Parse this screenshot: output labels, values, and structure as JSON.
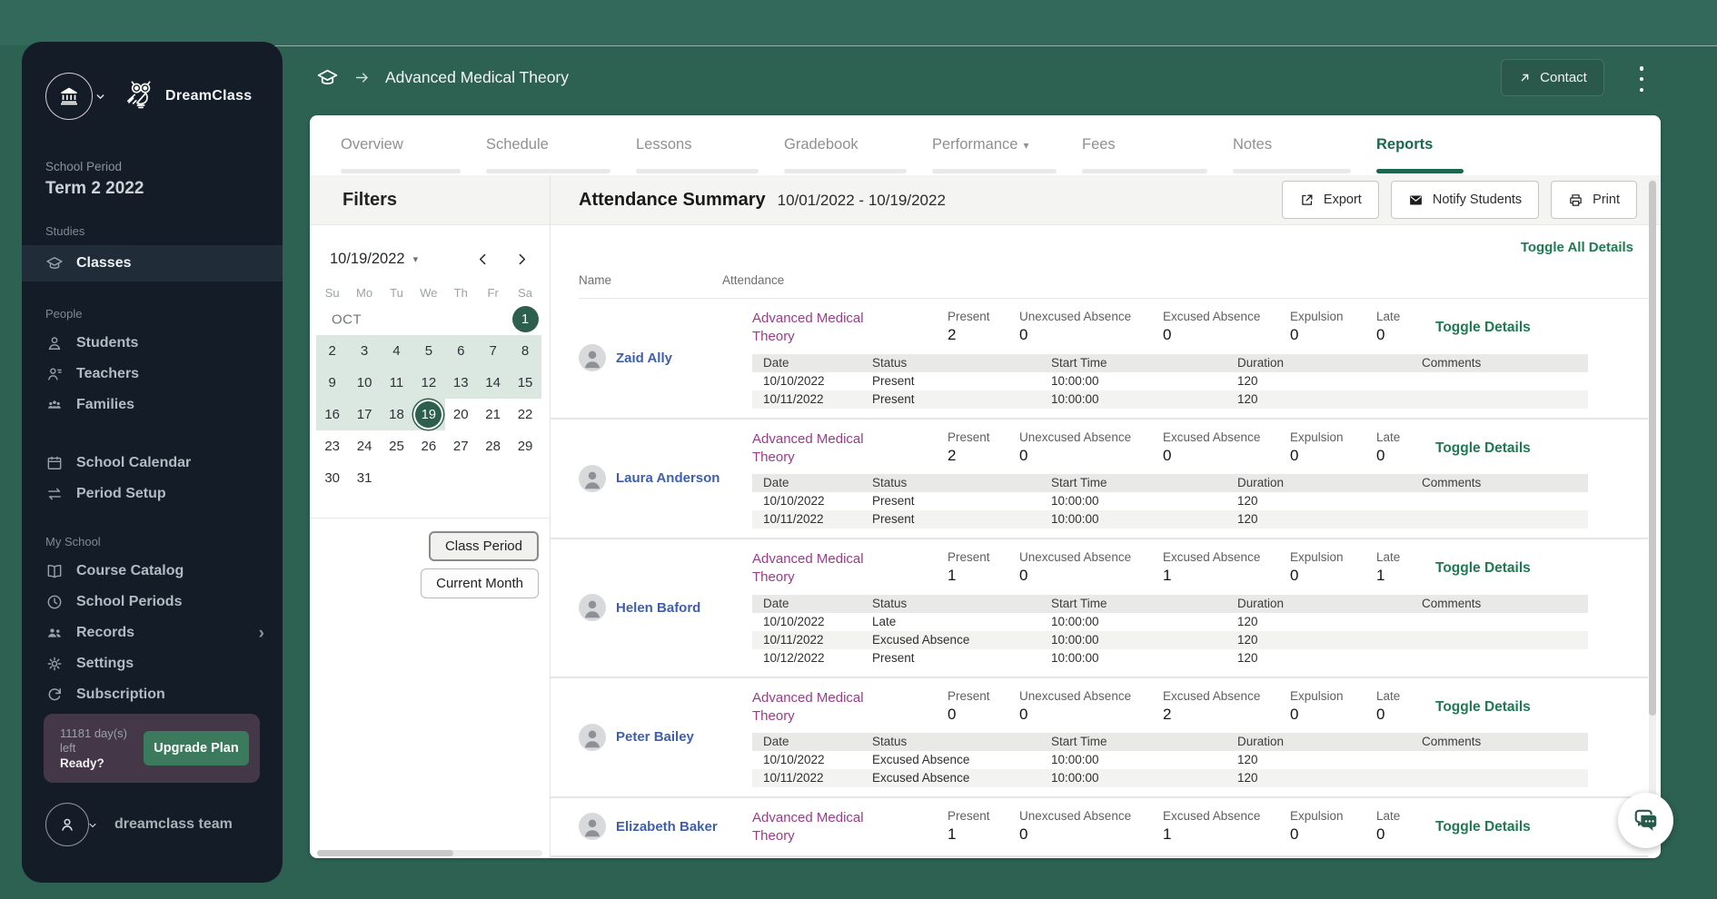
{
  "app": {
    "breadcrumb_title": "Advanced Medical Theory",
    "contact_label": "Contact"
  },
  "colors": {
    "background_green": "#2d6152",
    "sidebar_bg": "#141d27",
    "accent_green": "#1d6650",
    "calendar_highlight": "#dbe7e1",
    "selected_day": "#2d5f4e",
    "link_blue": "#3e5fae",
    "class_purple": "#9c3a8c",
    "upgrade_panel": "#443747"
  },
  "sidebar": {
    "brand": "DreamClass",
    "school_period_label": "School Period",
    "school_period_value": "Term 2 2022",
    "sections": [
      {
        "label": "Studies",
        "items": [
          {
            "label": "Classes",
            "icon": "grad-cap",
            "active": true
          }
        ]
      },
      {
        "label": "People",
        "items": [
          {
            "label": "Students",
            "icon": "student"
          },
          {
            "label": "Teachers",
            "icon": "teacher"
          },
          {
            "label": "Families",
            "icon": "families"
          }
        ]
      },
      {
        "label": "",
        "items": [
          {
            "label": "School Calendar",
            "icon": "calendar"
          },
          {
            "label": "Period Setup",
            "icon": "swap"
          }
        ]
      },
      {
        "label": "My School",
        "items": [
          {
            "label": "Course Catalog",
            "icon": "book"
          },
          {
            "label": "School Periods",
            "icon": "clock"
          },
          {
            "label": "Records",
            "icon": "people",
            "chevron": true
          },
          {
            "label": "Settings",
            "icon": "gear"
          },
          {
            "label": "Subscription",
            "icon": "refresh"
          }
        ]
      }
    ],
    "upgrade": {
      "days_line1": "11181 day(s)",
      "days_line2": "left",
      "ready": "Ready?",
      "button": "Upgrade Plan"
    },
    "account": "dreamclass team"
  },
  "tabs": [
    {
      "label": "Overview"
    },
    {
      "label": "Schedule"
    },
    {
      "label": "Lessons"
    },
    {
      "label": "Gradebook"
    },
    {
      "label": "Performance",
      "caret": true
    },
    {
      "label": "Fees"
    },
    {
      "label": "Notes"
    },
    {
      "label": "Reports",
      "active": true
    }
  ],
  "filters": {
    "title": "Filters",
    "date": "10/19/2022",
    "weekdays": [
      "Su",
      "Mo",
      "Tu",
      "We",
      "Th",
      "Fr",
      "Sa"
    ],
    "weeks": [
      {
        "label": "OCT",
        "cells": [
          null,
          null,
          null,
          null,
          null,
          null,
          {
            "d": "1",
            "sel": "filled"
          }
        ]
      },
      {
        "cells": [
          {
            "d": "2",
            "hl": true
          },
          {
            "d": "3",
            "hl": true
          },
          {
            "d": "4",
            "hl": true
          },
          {
            "d": "5",
            "hl": true
          },
          {
            "d": "6",
            "hl": true
          },
          {
            "d": "7",
            "hl": true
          },
          {
            "d": "8",
            "hl": true
          }
        ]
      },
      {
        "cells": [
          {
            "d": "9",
            "hl": true
          },
          {
            "d": "10",
            "hl": true
          },
          {
            "d": "11",
            "hl": true
          },
          {
            "d": "12",
            "hl": true
          },
          {
            "d": "13",
            "hl": true
          },
          {
            "d": "14",
            "hl": true
          },
          {
            "d": "15",
            "hl": true
          }
        ]
      },
      {
        "cells": [
          {
            "d": "16",
            "hl": true
          },
          {
            "d": "17",
            "hl": true
          },
          {
            "d": "18",
            "hl": true
          },
          {
            "d": "19",
            "hl": true,
            "sel": "ring"
          },
          {
            "d": "20"
          },
          {
            "d": "21"
          },
          {
            "d": "22"
          }
        ]
      },
      {
        "cells": [
          {
            "d": "23"
          },
          {
            "d": "24"
          },
          {
            "d": "25"
          },
          {
            "d": "26"
          },
          {
            "d": "27"
          },
          {
            "d": "28"
          },
          {
            "d": "29"
          }
        ]
      },
      {
        "cells": [
          {
            "d": "30"
          },
          {
            "d": "31"
          },
          null,
          null,
          null,
          null,
          null
        ]
      }
    ],
    "buttons": [
      "Class Period",
      "Current Month"
    ]
  },
  "report": {
    "title": "Attendance Summary",
    "range": "10/01/2022 - 10/19/2022",
    "actions": [
      {
        "label": "Export",
        "icon": "export"
      },
      {
        "label": "Notify Students",
        "icon": "mail"
      },
      {
        "label": "Print",
        "icon": "print"
      }
    ],
    "toggle_all": "Toggle All Details",
    "columns": {
      "name": "Name",
      "attendance": "Attendance"
    },
    "class_name": "Advanced Medical Theory",
    "stat_labels": [
      "Present",
      "Unexcused Absence",
      "Excused Absence",
      "Expulsion",
      "Late"
    ],
    "detail_columns": [
      "Date",
      "Status",
      "Start Time",
      "Duration",
      "Comments"
    ],
    "toggle_details": "Toggle Details",
    "students": [
      {
        "name": "Zaid Ally",
        "stats": [
          "2",
          "0",
          "0",
          "0",
          "0"
        ],
        "details": [
          [
            "10/10/2022",
            "Present",
            "10:00:00",
            "120",
            ""
          ],
          [
            "10/11/2022",
            "Present",
            "10:00:00",
            "120",
            ""
          ]
        ]
      },
      {
        "name": "Laura Anderson",
        "stats": [
          "2",
          "0",
          "0",
          "0",
          "0"
        ],
        "details": [
          [
            "10/10/2022",
            "Present",
            "10:00:00",
            "120",
            ""
          ],
          [
            "10/11/2022",
            "Present",
            "10:00:00",
            "120",
            ""
          ]
        ]
      },
      {
        "name": "Helen Baford",
        "stats": [
          "1",
          "0",
          "1",
          "0",
          "1"
        ],
        "details": [
          [
            "10/10/2022",
            "Late",
            "10:00:00",
            "120",
            ""
          ],
          [
            "10/11/2022",
            "Excused Absence",
            "10:00:00",
            "120",
            ""
          ],
          [
            "10/12/2022",
            "Present",
            "10:00:00",
            "120",
            ""
          ]
        ]
      },
      {
        "name": "Peter Bailey",
        "stats": [
          "0",
          "0",
          "2",
          "0",
          "0"
        ],
        "details": [
          [
            "10/10/2022",
            "Excused Absence",
            "10:00:00",
            "120",
            ""
          ],
          [
            "10/11/2022",
            "Excused Absence",
            "10:00:00",
            "120",
            ""
          ]
        ]
      },
      {
        "name": "Elizabeth Baker",
        "stats": [
          "1",
          "0",
          "1",
          "0",
          "0"
        ],
        "details": []
      }
    ]
  }
}
